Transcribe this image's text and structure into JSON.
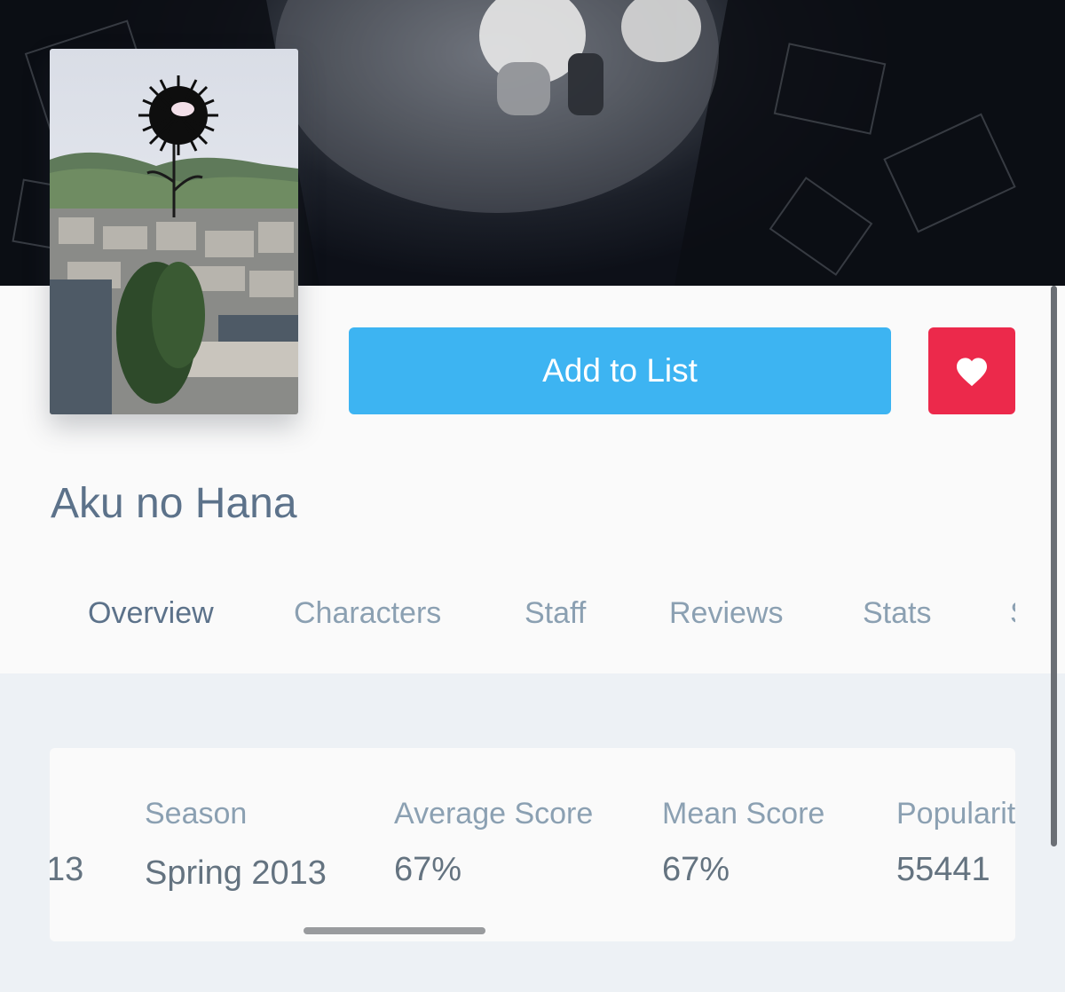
{
  "media": {
    "title": "Aku no Hana"
  },
  "actions": {
    "add_to_list_label": "Add to List"
  },
  "tabs": [
    {
      "label": "Overview",
      "active": true
    },
    {
      "label": "Characters",
      "active": false
    },
    {
      "label": "Staff",
      "active": false
    },
    {
      "label": "Reviews",
      "active": false
    },
    {
      "label": "Stats",
      "active": false
    },
    {
      "label": "S",
      "active": false
    }
  ],
  "stats": {
    "cut_value": "13",
    "items": [
      {
        "label": "Season",
        "value": "Spring 2013"
      },
      {
        "label": "Average Score",
        "value": "67%"
      },
      {
        "label": "Mean Score",
        "value": "67%"
      },
      {
        "label": "Popularity",
        "value": "55441"
      }
    ]
  },
  "colors": {
    "accent_blue": "#3db4f2",
    "favorite_red": "#ec294b",
    "title_text": "#5c728a",
    "muted_text": "#8ba0b2"
  }
}
